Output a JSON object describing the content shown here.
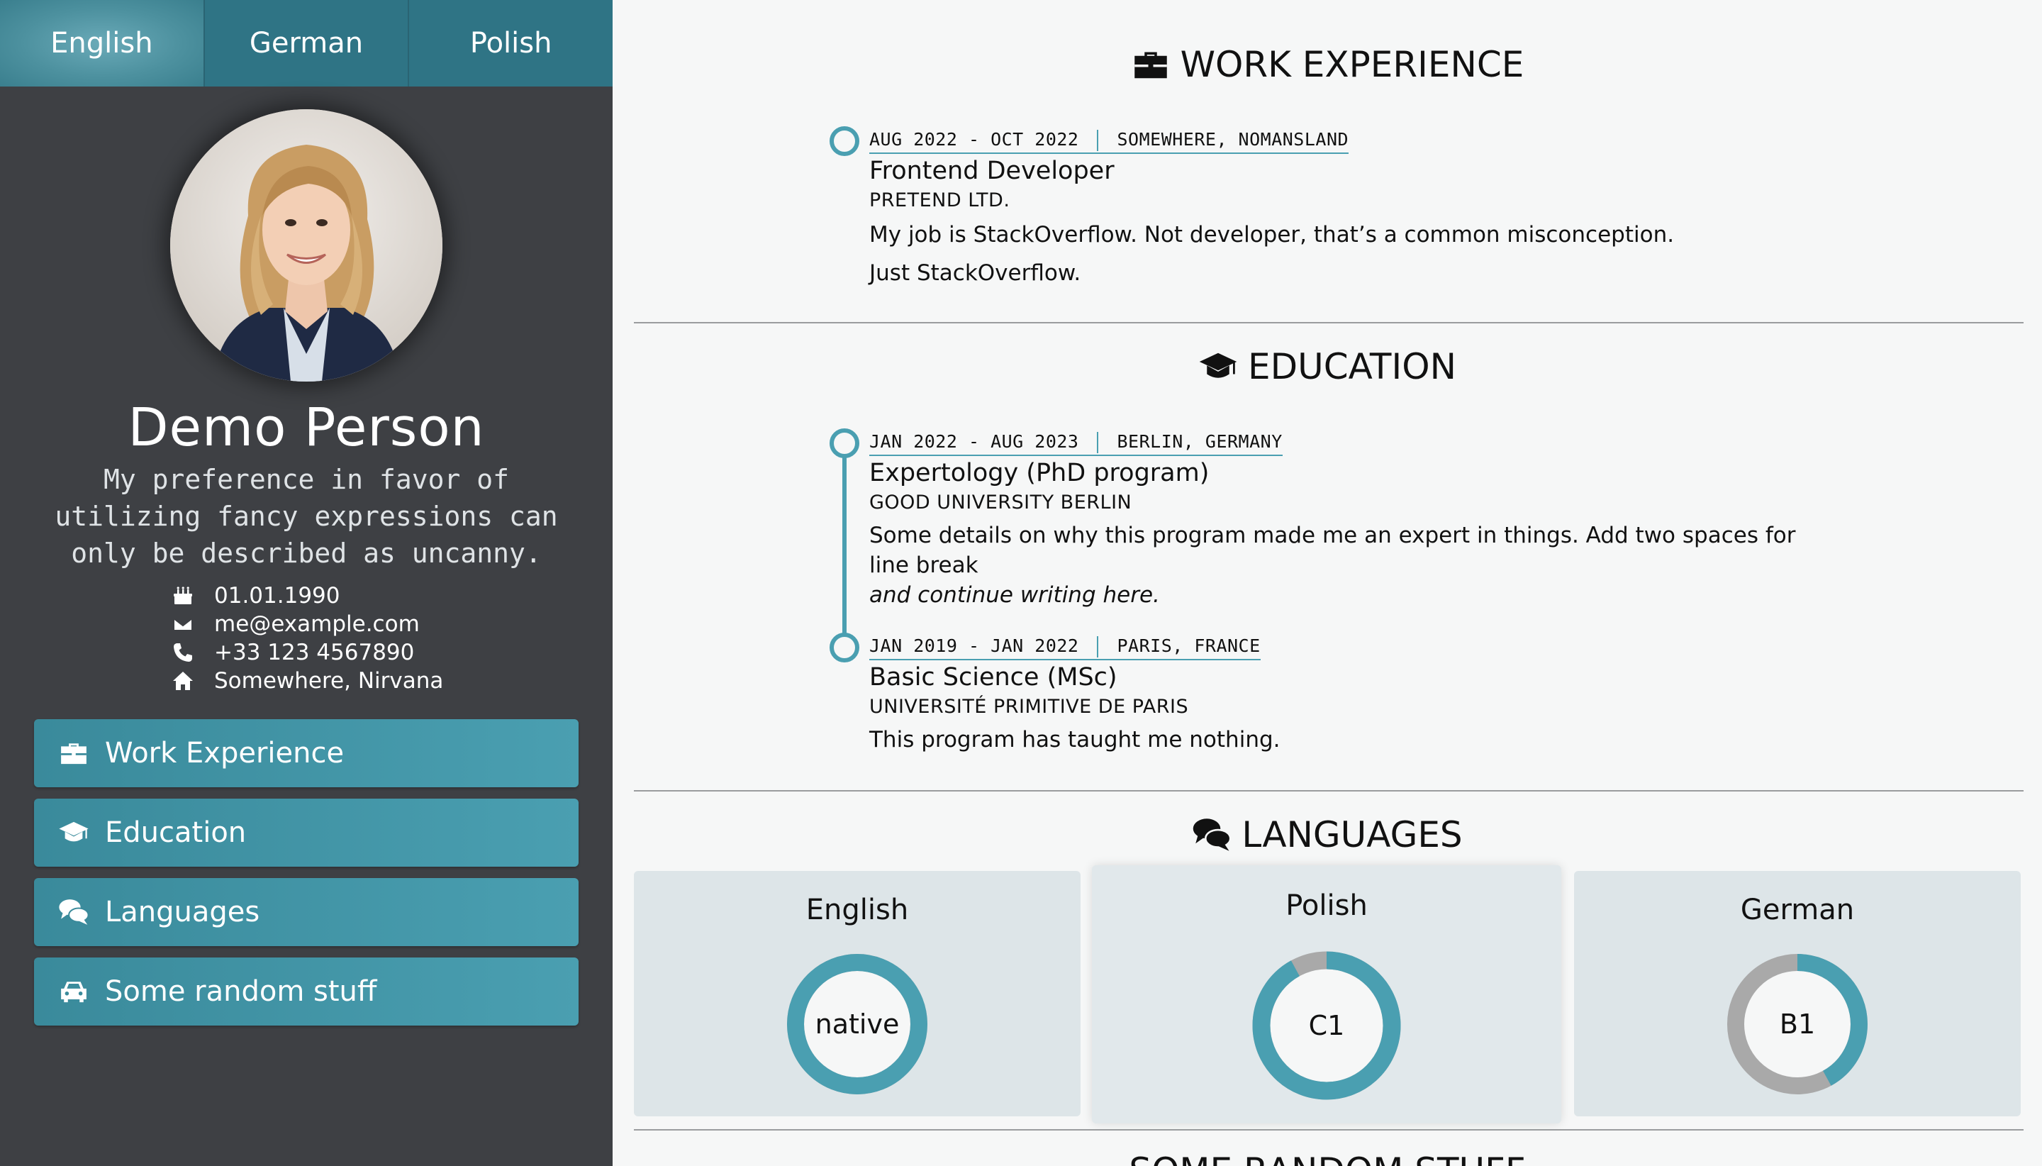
{
  "language_tabs": [
    "English",
    "German",
    "Polish"
  ],
  "profile": {
    "name": "Demo Person",
    "tagline": "My preference in favor of utilizing fancy expressions can only be described as uncanny.",
    "birthday": "01.01.1990",
    "email": "me@example.com",
    "phone": "+33 123 4567890",
    "address": "Somewhere, Nirvana"
  },
  "nav": {
    "work": "Work Experience",
    "education": "Education",
    "languages": "Languages",
    "random": "Some random stuff"
  },
  "sections": {
    "work_title": "WORK EXPERIENCE",
    "education_title": "EDUCATION",
    "languages_title": "LANGUAGES",
    "random_title": "SOME RANDOM STUFF"
  },
  "work": [
    {
      "dates": "AUG 2022 - OCT 2022",
      "location": "SOMEWHERE, NOMANSLAND",
      "role": "Frontend Developer",
      "org": "PRETEND LTD.",
      "desc_1": "My job is StackOverflow. Not developer, that’s a common misconception.",
      "desc_2": "Just StackOverflow."
    }
  ],
  "education": [
    {
      "dates": "JAN 2022 - AUG 2023",
      "location": "BERLIN, GERMANY",
      "role": "Expertology (PhD program)",
      "org": "GOOD UNIVERSITY BERLIN",
      "desc_1": "Some details on why this program made me an expert in things. Add two spaces for line break",
      "desc_2": "and continue writing here."
    },
    {
      "dates": "JAN 2019 - JAN 2022",
      "location": "PARIS, FRANCE",
      "role": "Basic Science (MSc)",
      "org": "UNIVERSITÉ PRIMITIVE DE PARIS",
      "desc_1": "This program has taught me nothing."
    }
  ],
  "languages": [
    {
      "name": "English",
      "level": "native",
      "fill": 1.0
    },
    {
      "name": "Polish",
      "level": "C1",
      "fill": 0.92
    },
    {
      "name": "German",
      "level": "B1",
      "fill": 0.42
    }
  ],
  "colors": {
    "accent": "#4a9fb1",
    "sidebar": "#3e4044",
    "donut_track": "#a9a9a9"
  }
}
